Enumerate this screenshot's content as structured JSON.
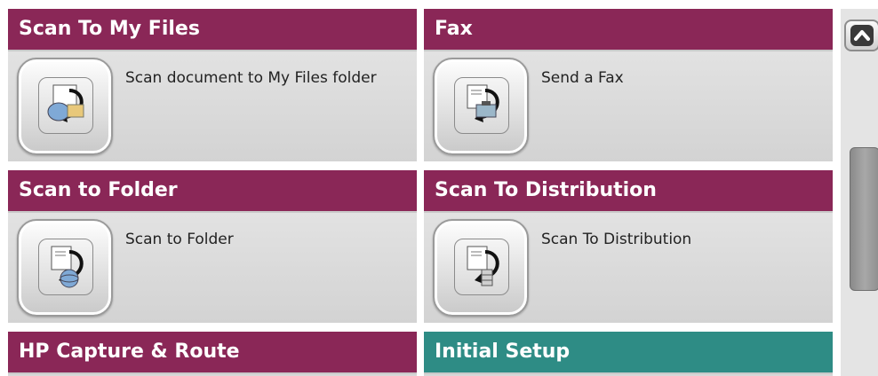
{
  "tiles": [
    {
      "title": "Scan To My Files",
      "description": "Scan document to  My Files folder",
      "color": "#8a2757",
      "icon": "scan-to-my-files-icon"
    },
    {
      "title": "Fax",
      "description": "Send a Fax",
      "color": "#8a2757",
      "icon": "fax-icon"
    },
    {
      "title": "Scan to Folder",
      "description": "Scan to Folder",
      "color": "#8a2757",
      "icon": "scan-to-folder-icon"
    },
    {
      "title": "Scan To Distribution",
      "description": "Scan To Distribution",
      "color": "#8a2757",
      "icon": "scan-to-distribution-icon"
    },
    {
      "title": "HP Capture & Route",
      "color": "#8a2757"
    },
    {
      "title": "Initial Setup",
      "color": "#2e8c85"
    }
  ],
  "scrollbar": {
    "up_icon": "chevron-up-icon"
  }
}
